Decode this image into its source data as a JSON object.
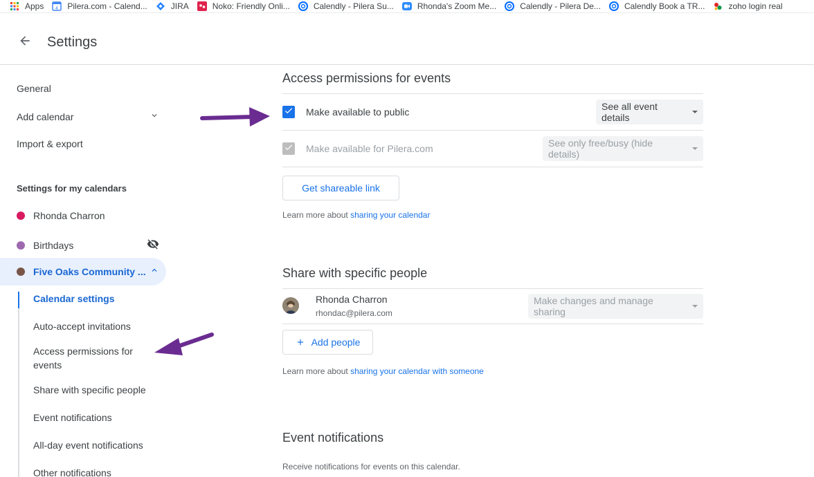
{
  "bookmarks": [
    {
      "label": "Apps",
      "icon": "apps-grid-icon"
    },
    {
      "label": "Pilera.com - Calend...",
      "icon": "google-calendar-icon"
    },
    {
      "label": "JIRA",
      "icon": "jira-icon"
    },
    {
      "label": "Noko: Friendly Onli...",
      "icon": "noko-icon"
    },
    {
      "label": "Calendly - Pilera Su...",
      "icon": "calendly-icon"
    },
    {
      "label": "Rhonda's Zoom Me...",
      "icon": "zoom-icon"
    },
    {
      "label": "Calendly - Pilera De...",
      "icon": "calendly-icon"
    },
    {
      "label": "Calendly Book a TR...",
      "icon": "calendly-icon"
    },
    {
      "label": "zoho login real",
      "icon": "zoho-icon"
    }
  ],
  "header": {
    "title": "Settings"
  },
  "sidebar": {
    "general": "General",
    "add_calendar": "Add calendar",
    "import_export": "Import & export",
    "my_calendars_heading": "Settings for my calendars",
    "calendars": [
      {
        "name": "Rhonda Charron",
        "color": "#d81b60"
      },
      {
        "name": "Birthdays",
        "color": "#9e69af"
      },
      {
        "name": "Five Oaks Community ...",
        "color": "#795548"
      }
    ],
    "sub_items": [
      "Calendar settings",
      "Auto-accept invitations",
      "Access permissions for events",
      "Share with specific people",
      "Event notifications",
      "All-day event notifications",
      "Other notifications"
    ]
  },
  "access": {
    "title": "Access permissions for events",
    "public_label": "Make available to public",
    "public_option": "See all event details",
    "domain_label": "Make available for Pilera.com",
    "domain_option": "See only free/busy (hide details)",
    "share_link_button": "Get shareable link",
    "learn_prefix": "Learn more about ",
    "learn_link": "sharing your calendar"
  },
  "share": {
    "title": "Share with specific people",
    "person_name": "Rhonda Charron",
    "person_email": "rhondac@pilera.com",
    "person_permission": "Make changes and manage sharing",
    "add_people_button": "Add people",
    "learn_prefix": "Learn more about ",
    "learn_link": "sharing your calendar with someone"
  },
  "notifications": {
    "title": "Event notifications",
    "description": "Receive notifications for events on this calendar."
  },
  "colors": {
    "accent": "#1a73e8",
    "annotation_arrow": "#6a2c91"
  }
}
